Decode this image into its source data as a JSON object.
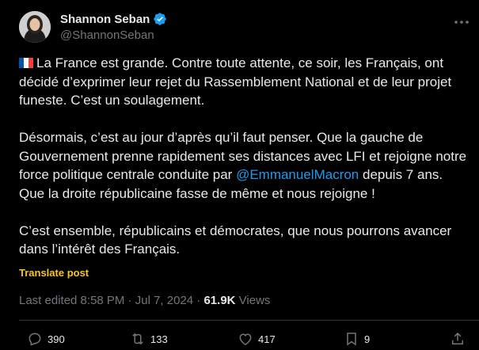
{
  "author": {
    "name": "Shannon Seban",
    "handle": "@ShannonSeban"
  },
  "post": {
    "p1": "La France est grande. Contre toute attente, ce soir, les Français, ont décidé d’exprimer leur rejet du Rassemblement National et de leur projet funeste. C’est un soulagement.",
    "p2_before": "Désormais, c’est au jour d’après qu’il faut penser. Que la gauche de Gouvernement prenne rapidement ses distances avec LFI et rejoigne notre force politique centrale conduite par ",
    "p2_mention": "@EmmanuelMacron",
    "p2_after": " depuis 7 ans. Que la droite républicaine fasse de même et nous rejoigne !",
    "p3": "C’est ensemble, républicains et démocrates, que nous pourrons avancer dans l’intérêt des Français."
  },
  "translate_label": "Translate post",
  "meta": {
    "edited": "Last edited 8:58 PM · Jul 7, 2024 · ",
    "views_count": "61.9K",
    "views_label": " Views"
  },
  "actions": {
    "replies": "390",
    "reposts": "133",
    "likes": "417",
    "bookmarks": "9"
  },
  "colors": {
    "background": "#000000",
    "text": "#e7e9ea",
    "muted": "#71767b",
    "mention": "#1d9bf0",
    "translate": "#f9c51f",
    "verified": "#1d9bf0"
  }
}
